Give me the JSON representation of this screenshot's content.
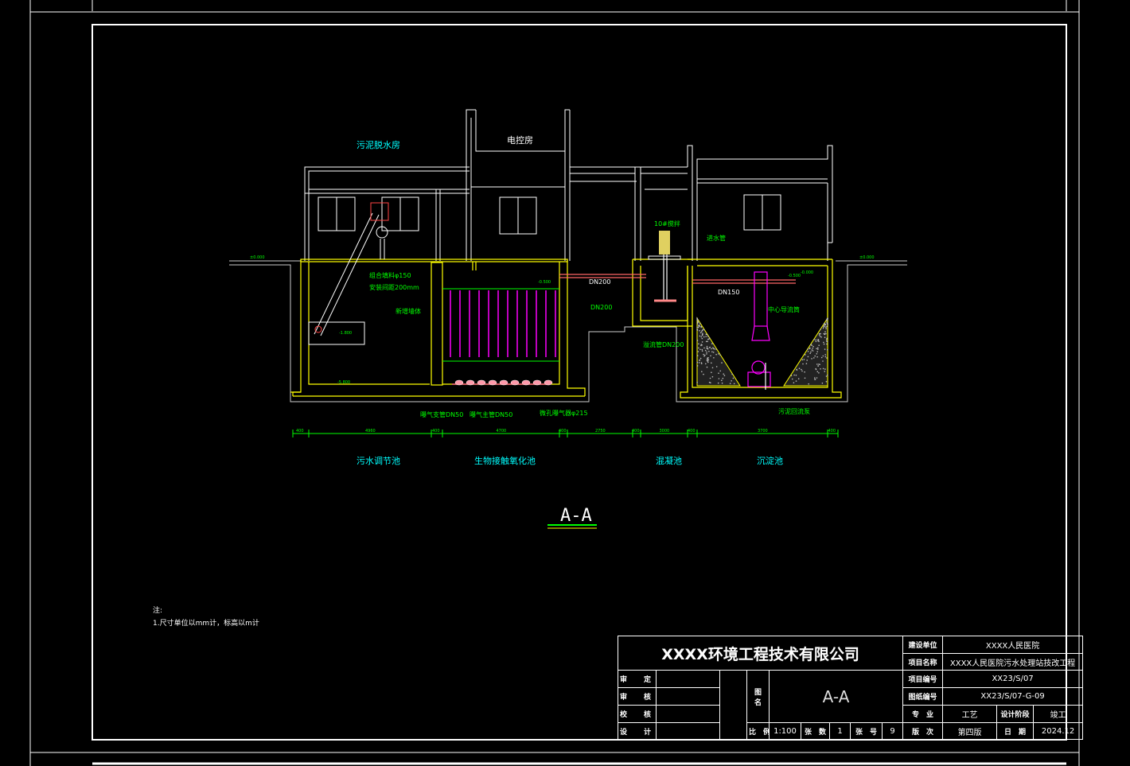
{
  "section_title": "A-A",
  "buildings": {
    "sludge_room": "污泥脱水房",
    "control_room": "电控房"
  },
  "tanks": [
    {
      "key": "regulating",
      "label": "污水调节池"
    },
    {
      "key": "bio",
      "label": "生物接触氧化池"
    },
    {
      "key": "coag",
      "label": "混凝池"
    },
    {
      "key": "sed",
      "label": "沉淀池"
    }
  ],
  "annotations": {
    "filler": "组合填料φ150",
    "spacing": "安装间距200mm",
    "new_wall": "新增墙体",
    "dn200a": "DN200",
    "dn200b": "DN200",
    "dn150": "DN150",
    "agitator": "10#搅拌",
    "sed_pipe": "DN200",
    "inlet": "溢流管DN200",
    "center_pipe": "中心导流筒",
    "return_pump": "污泥回流泵",
    "aer_branch": "曝气支管DN50",
    "aer_main": "曝气主管DN50",
    "diffuser": "微孔曝气器φ215",
    "coag_inlet": "进水管",
    "elev_ground_l": "±0.000",
    "elev_ground_r": "±0.000",
    "elev_water1": "-1.800",
    "elev_bottom1": "-5.800",
    "elev_bio": "-0.500",
    "elev_sed": "-0.500",
    "elev_sed2": "-0.000"
  },
  "dimensions": [
    "400",
    "4960",
    "400",
    "4700",
    "400",
    "2750",
    "400",
    "3000",
    "400",
    "3700",
    "400"
  ],
  "notes": {
    "title": "注:",
    "line1": "1.尺寸单位以mm计，标高以m计"
  },
  "title_block": {
    "company": "XXXX环境工程技术有限公司",
    "roles": [
      "审　定",
      "审　核",
      "校　核",
      "设　计"
    ],
    "drawing_name_label": "图　名",
    "drawing_name": "A-A",
    "scale_label": "比　例",
    "scale": "1:100",
    "sheets_label": "张　数",
    "sheets": "1",
    "sheet_no_label": "张　号",
    "sheet_no": "9",
    "client_label": "建设单位",
    "client": "XXXX人民医院",
    "project_label": "项目名称",
    "project": "XXXX人民医院污水处理站技改工程",
    "proj_no_label": "项目编号",
    "proj_no": "XX23/S/07",
    "drawing_no_label": "图纸编号",
    "drawing_no": "XX23/S/07-G-09",
    "discipline_label": "专　业",
    "discipline": "工艺",
    "phase_label": "设计阶段",
    "phase": "竣工",
    "edition_label": "版　次",
    "edition": "第四版",
    "date_label": "日　期",
    "date": "2024.12"
  },
  "colors": {
    "wall": "#ffff00",
    "building": "#ffffff",
    "annotation": "#00ff00",
    "label": "#00ffff",
    "media": "#ff00ff",
    "hatch": "#aaaaaa"
  }
}
